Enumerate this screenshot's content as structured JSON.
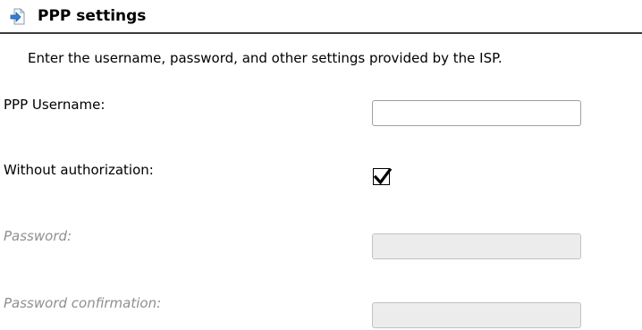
{
  "section": {
    "title": "PPP settings",
    "icon": "arrow-into-page-icon",
    "description": "Enter the username, password, and other settings provided by the ISP."
  },
  "fields": {
    "username": {
      "label": "PPP Username:",
      "value": "",
      "enabled": true
    },
    "without_authorization": {
      "label": "Without authorization:",
      "checked": true
    },
    "password": {
      "label": "Password:",
      "value": "",
      "enabled": false
    },
    "password_confirmation": {
      "label": "Password confirmation:",
      "value": "",
      "enabled": false
    }
  },
  "colors": {
    "header_rule": "#3a3a3a",
    "disabled_text": "#8f8f8f",
    "disabled_field": "#ececec",
    "icon_blue": "#2f7fd8"
  }
}
